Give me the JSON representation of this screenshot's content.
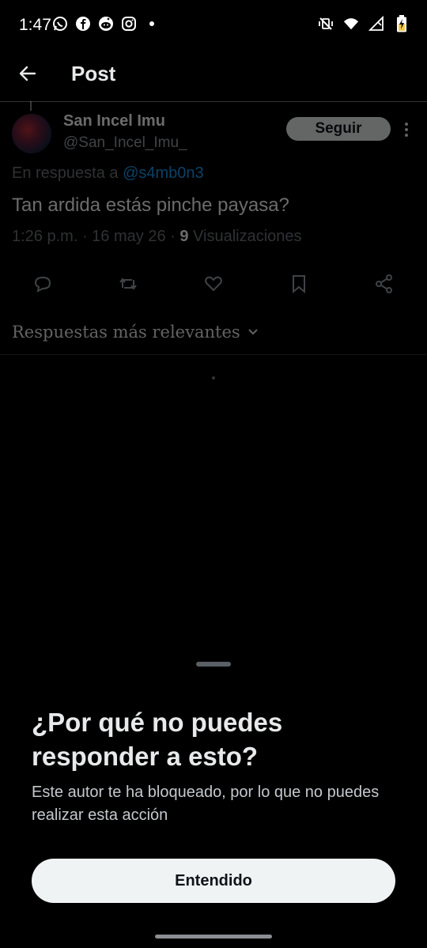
{
  "status_bar": {
    "time": "1:47",
    "left_icons": [
      "whatsapp-icon",
      "facebook-icon",
      "reddit-icon",
      "instagram-icon",
      "notification-dot-icon"
    ],
    "right_icons": [
      "vibrate-mute-icon",
      "wifi-icon",
      "signal-icon",
      "battery-charging-icon"
    ]
  },
  "header": {
    "title": "Post"
  },
  "tweet": {
    "display_name": "San Incel Imu",
    "handle": "@San_Incel_Imu_",
    "follow_label": "Seguir",
    "replying_prefix": "En respuesta a",
    "replying_mention": "@s4mb0n3",
    "text": "Tan ardida estás pinche payasa?",
    "time": "1:26 p.m.",
    "date": "16 may 26",
    "views_count": "9",
    "views_label": "Visualizaciones",
    "action_icons": [
      "reply-icon",
      "retweet-icon",
      "like-icon",
      "bookmark-icon",
      "share-icon"
    ]
  },
  "replies_sort": {
    "label": "Respuestas más relevantes"
  },
  "sheet": {
    "title": "¿Por qué no puedes responder a esto?",
    "body": "Este autor te ha bloqueado, por lo que no puedes realizar esta acción",
    "button_label": "Entendido"
  },
  "colors": {
    "accent": "#1d9bf0",
    "background": "#000000",
    "button": "#eff3f4"
  }
}
